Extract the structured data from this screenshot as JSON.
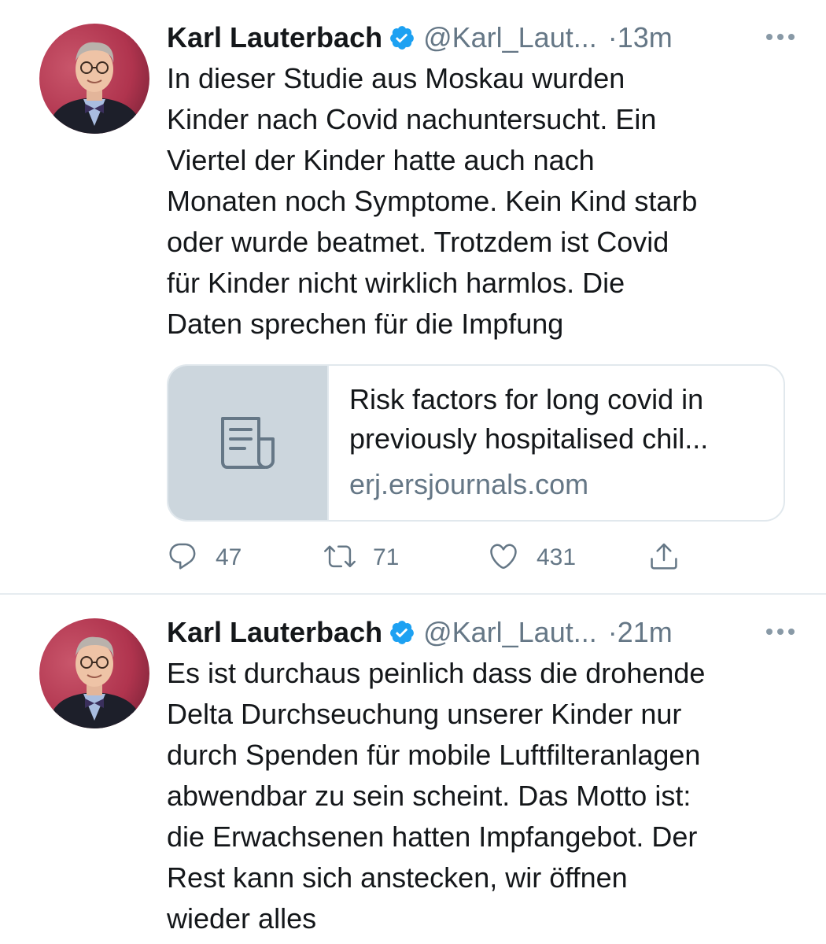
{
  "tweets": [
    {
      "author_name": "Karl Lauterbach",
      "handle": "@Karl_Laut...",
      "time": "·13m",
      "text": "In dieser Studie aus Moskau wurden\nKinder nach Covid nachuntersucht. Ein\nViertel der Kinder hatte auch nach\nMonaten noch Symptome. Kein Kind starb\noder wurde beatmet. Trotzdem ist Covid\nfür Kinder nicht wirklich harmlos. Die\nDaten sprechen für die Impfung",
      "card": {
        "title": "Risk factors for long covid in\npreviously hospitalised chil...",
        "domain": "erj.ersjournals.com",
        "thumb_icon": "document-icon"
      },
      "actions": {
        "replies": "47",
        "retweets": "71",
        "likes": "431"
      }
    },
    {
      "author_name": "Karl Lauterbach",
      "handle": "@Karl_Laut...",
      "time": "·21m",
      "text": "Es ist durchaus peinlich dass die drohende\nDelta Durchseuchung unserer Kinder nur\ndurch Spenden für mobile Luftfilteranlagen\nabwendbar zu sein scheint. Das Motto ist:\ndie Erwachsenen hatten Impfangebot. Der\nRest kann sich anstecken, wir öffnen\nwieder alles"
    }
  ],
  "colors": {
    "text": "#14171a",
    "secondary": "#657786",
    "verified": "#1da1f2",
    "border": "#e1e8ed",
    "card_thumb": "#ccd6dd"
  }
}
